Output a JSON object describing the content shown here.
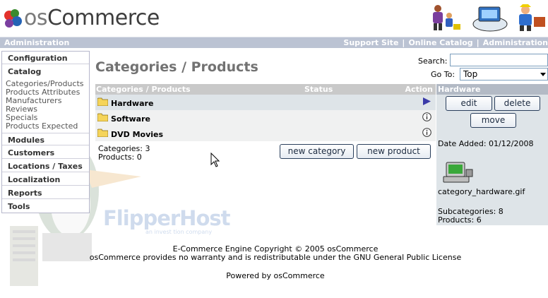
{
  "header": {
    "logo_prefix": "os",
    "logo_suffix": "Commerce"
  },
  "topbar": {
    "left": "Administration",
    "links": [
      "Support Site",
      "Online Catalog",
      "Administration"
    ],
    "separator": "|"
  },
  "sidebar": {
    "sections": [
      "Configuration",
      "Catalog",
      "Modules",
      "Customers",
      "Locations / Taxes",
      "Localization",
      "Reports",
      "Tools"
    ],
    "catalog_items": [
      "Categories/Products",
      "Products Attributes",
      "Manufacturers",
      "Reviews",
      "Specials",
      "Products Expected"
    ]
  },
  "main": {
    "title": "Categories / Products",
    "search_label": "Search:",
    "search_value": "",
    "goto_label": "Go To:",
    "goto_value": "Top",
    "columns": [
      "Categories / Products",
      "Status",
      "Action"
    ],
    "rows": [
      {
        "name": "Hardware",
        "action": "arrow"
      },
      {
        "name": "Software",
        "action": "info"
      },
      {
        "name": "DVD Movies",
        "action": "info"
      }
    ],
    "categories_count": "Categories: 3",
    "products_count": "Products: 0",
    "new_category_label": "new category",
    "new_product_label": "new product"
  },
  "infobox": {
    "heading": "Hardware",
    "edit_label": "edit",
    "delete_label": "delete",
    "move_label": "move",
    "date_added": "Date Added: 01/12/2008",
    "image_name": "category_hardware.gif",
    "subcategories": "Subcategories: 8",
    "products": "Products: 6"
  },
  "footer": {
    "line1": "E-Commerce Engine Copyright © 2005 osCommerce",
    "line2": "osCommerce provides no warranty and is redistributable under the GNU General Public License",
    "powered": "Powered by osCommerce"
  },
  "watermark": {
    "brand": "FlipperHost",
    "tagline": "an invest tion company"
  },
  "colors": {
    "admin_bar": "#bbc3d3",
    "table_header": "#c9c9c9",
    "info_box": "#dee4e8",
    "title": "#727272"
  }
}
